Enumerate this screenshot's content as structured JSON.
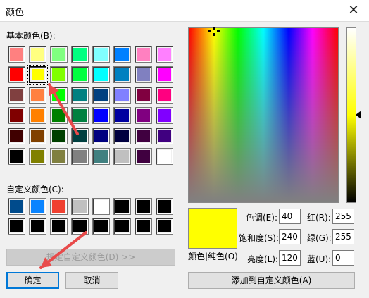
{
  "window": {
    "title": "颜色",
    "close_glyph": "✕"
  },
  "labels": {
    "basic_colors": "基本颜色(B):",
    "custom_colors": "自定义颜色(C):",
    "color_solid": "颜色|纯色(O)"
  },
  "basic_colors": [
    [
      "#ff8080",
      "#ffff80",
      "#80ff80",
      "#00ff80",
      "#80ffff",
      "#0080ff",
      "#ff80c0",
      "#ff80ff"
    ],
    [
      "#ff0000",
      "#ffff00",
      "#80ff00",
      "#00ff40",
      "#00ffff",
      "#0080c0",
      "#8080c0",
      "#ff00ff"
    ],
    [
      "#804040",
      "#ff8040",
      "#00ff00",
      "#008080",
      "#004080",
      "#8080ff",
      "#800040",
      "#ff0080"
    ],
    [
      "#800000",
      "#ff8000",
      "#008000",
      "#008040",
      "#0000ff",
      "#0000a0",
      "#800080",
      "#8000ff"
    ],
    [
      "#400000",
      "#804000",
      "#004000",
      "#004040",
      "#000080",
      "#000040",
      "#400040",
      "#400080"
    ],
    [
      "#000000",
      "#808000",
      "#808040",
      "#808080",
      "#408080",
      "#c0c0c0",
      "#400040",
      "#ffffff"
    ]
  ],
  "selected_basic": [
    1,
    1
  ],
  "custom_colors": [
    [
      "#004b8c",
      "#0a84ff",
      "#f04030",
      "#c0c0c0",
      "#ffffff",
      "#000000",
      "#000000",
      "#000000"
    ],
    [
      "#000000",
      "#000000",
      "#000000",
      "#000000",
      "#000000",
      "#000000",
      "#000000",
      "#000000"
    ]
  ],
  "buttons": {
    "define_custom": "规定自定义颜色(D) >>",
    "ok": "确定",
    "cancel": "取消",
    "add_custom": "添加到自定义颜色(A)"
  },
  "fields": {
    "hue": {
      "label": "色调(E):",
      "value": "40"
    },
    "sat": {
      "label": "饱和度(S):",
      "value": "240"
    },
    "lum": {
      "label": "亮度(L):",
      "value": "120"
    },
    "red": {
      "label": "红(R):",
      "value": "255"
    },
    "green": {
      "label": "绿(G):",
      "value": "255"
    },
    "blue": {
      "label": "蓝(U):",
      "value": "0"
    }
  },
  "current_color": "#ffff00",
  "annotation_color": "#e84a4a"
}
